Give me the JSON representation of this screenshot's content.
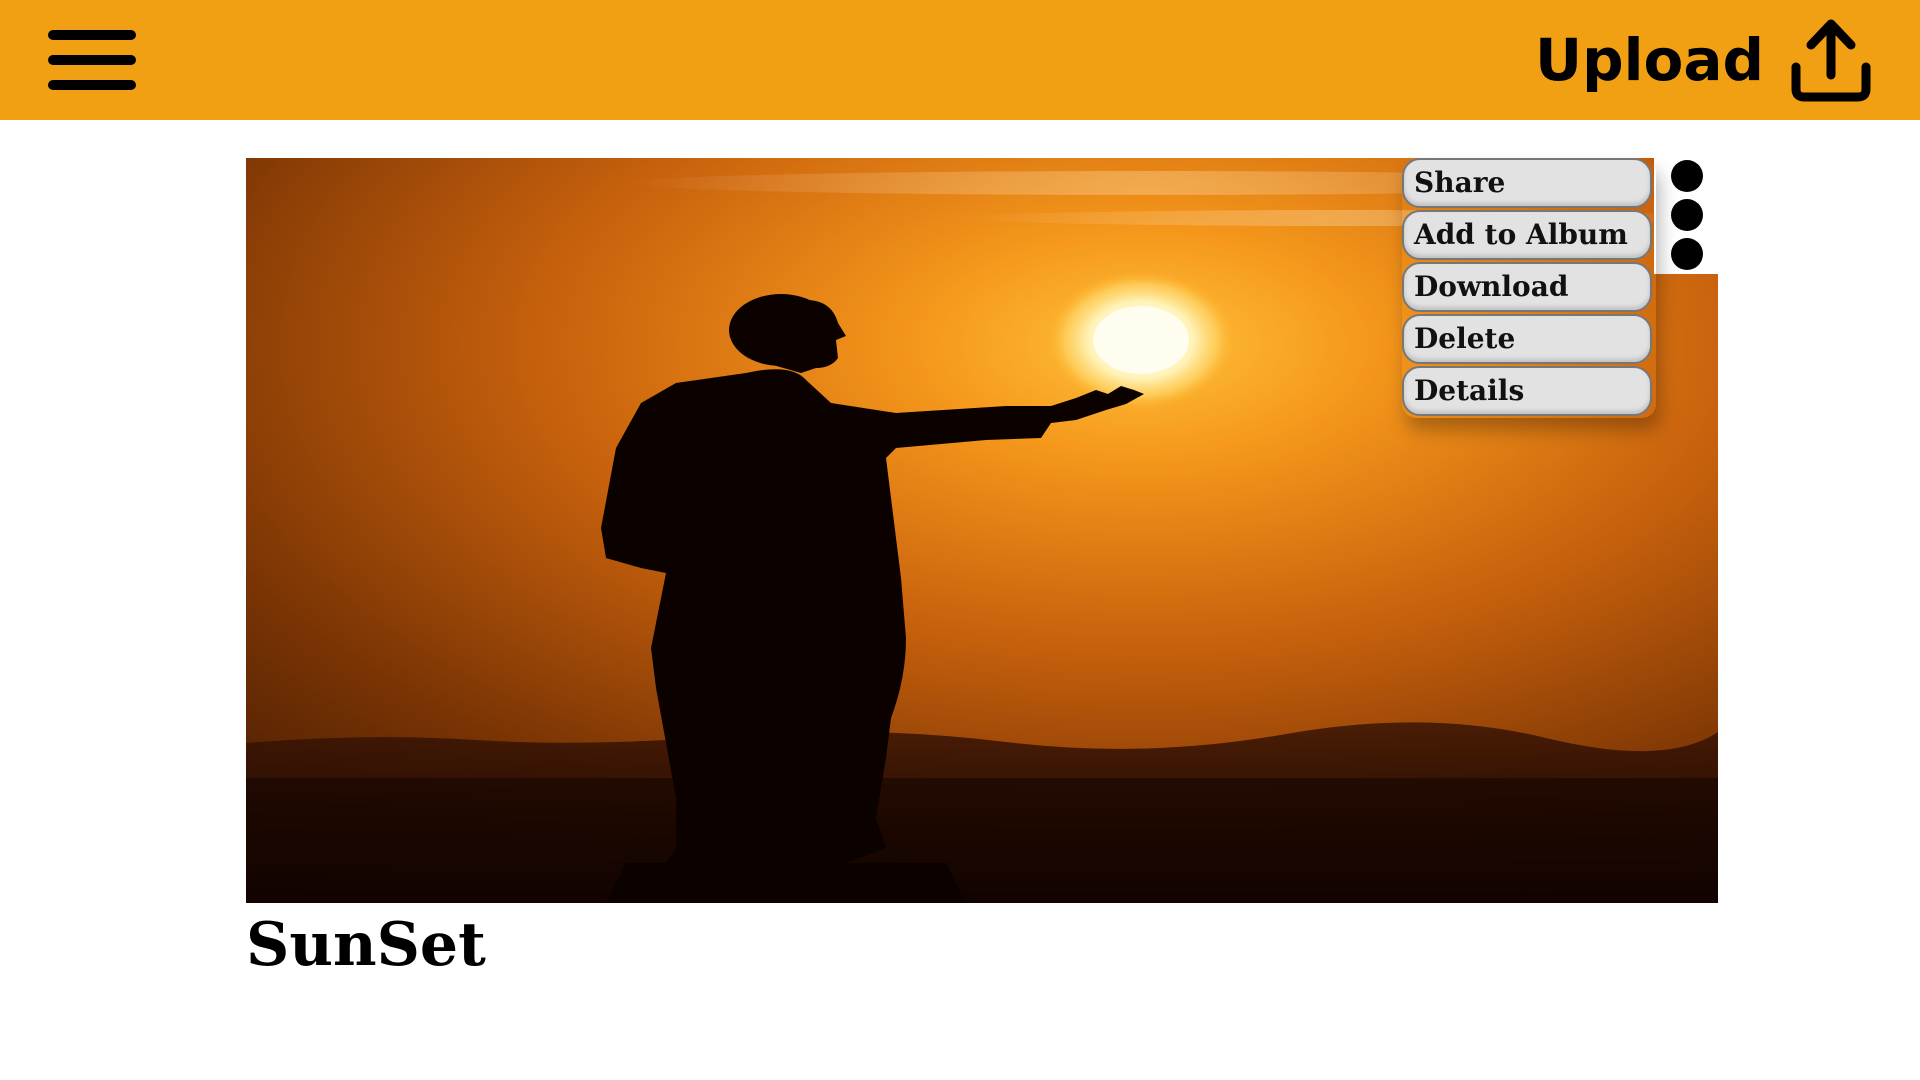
{
  "header": {
    "menu_icon": "hamburger-icon",
    "upload_label": "Upload",
    "upload_icon": "upload-icon",
    "background_color": "#f1a014"
  },
  "photo": {
    "title": "SunSet"
  },
  "more_options_icon": "vertical-ellipsis-icon",
  "context_menu": {
    "items": [
      {
        "label": "Share"
      },
      {
        "label": "Add to Album"
      },
      {
        "label": "Download"
      },
      {
        "label": "Delete"
      },
      {
        "label": "Details"
      }
    ]
  }
}
